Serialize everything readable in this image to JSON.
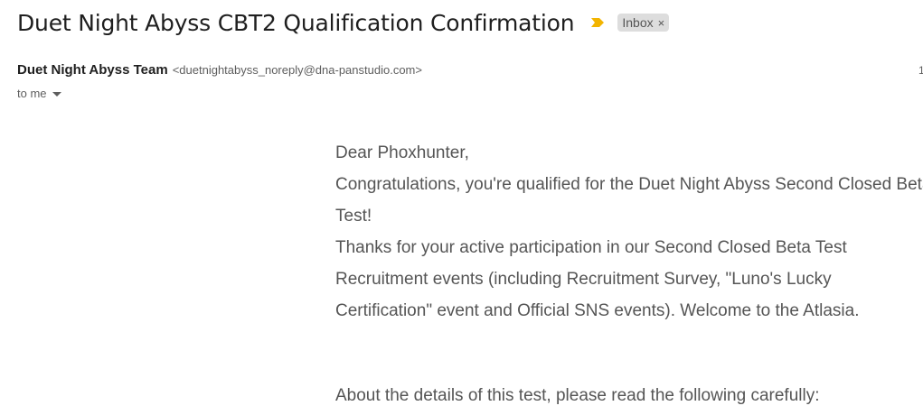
{
  "email": {
    "subject": "Duet Night Abyss CBT2 Qualification Confirmation",
    "label_chip": "Inbox",
    "label_chip_close": "×",
    "sender_name": "Duet Night Abyss Team",
    "sender_email": "<duetnightabyss_noreply@dna-panstudio.com>",
    "date_partial": "1",
    "recipient": "to me",
    "importance_color": "#f2b400"
  },
  "body": {
    "greeting": "Dear Phoxhunter,",
    "line1": "Congratulations, you're qualified for the Duet Night Abyss Second Closed Beta Test!",
    "line2": "Thanks for your active participation in our Second Closed Beta Test Recruitment events (including Recruitment Survey, \"Luno's Lucky Certification\" event and Official SNS events). Welcome to the Atlasia.",
    "line3": "About the details of this test, please read the following carefully:"
  }
}
